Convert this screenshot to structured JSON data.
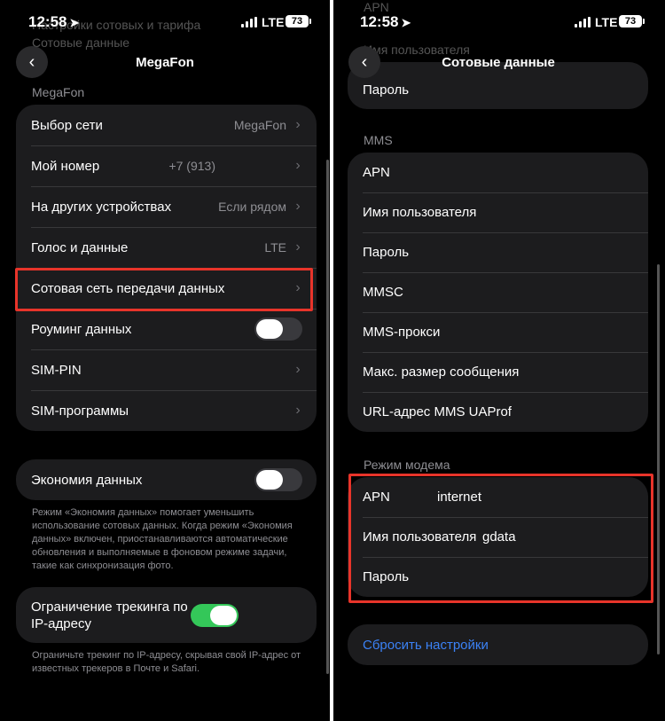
{
  "left": {
    "status": {
      "time": "12:58",
      "network": "LTE",
      "battery": "73"
    },
    "nav": {
      "title": "MegaFon"
    },
    "ghost_text": [
      "Настройки сотовых и тарифа",
      "Сотовые данные"
    ],
    "section_label": "MegaFon",
    "main_rows": [
      {
        "label": "Выбор сети",
        "value": "MegaFon"
      },
      {
        "label": "Мой номер",
        "value": "+7 (913)"
      },
      {
        "label": "На других устройствах",
        "value": "Если рядом"
      },
      {
        "label": "Голос и данные",
        "value": "LTE"
      },
      {
        "label": "Сотовая сеть передачи данных",
        "value": ""
      },
      {
        "label": "Роуминг данных",
        "toggle": false
      },
      {
        "label": "SIM-PIN",
        "value": ""
      },
      {
        "label": "SIM-программы",
        "value": ""
      }
    ],
    "economy": {
      "label": "Экономия данных",
      "toggle": false,
      "footnote": "Режим «Экономия данных» помогает уменьшить использование сотовых данных. Когда режим «Экономия данных» включен, приостанавливаются автоматические обновления и выполняемые в фоновом режиме задачи, такие как синхронизация фото."
    },
    "tracking": {
      "label": "Ограничение трекинга по IP-адресу",
      "toggle": true,
      "footnote": "Ограничьте трекинг по IP-адресу, скрывая свой IP-адрес от известных трекеров в Почте и Safari."
    }
  },
  "right": {
    "status": {
      "time": "12:58",
      "network": "LTE",
      "battery": "73"
    },
    "nav": {
      "title": "Сотовые данные"
    },
    "ghost_text": [
      "APN",
      "Имя пользователя"
    ],
    "top_password": "Пароль",
    "mms_label": "MMS",
    "mms_rows": [
      "APN",
      "Имя пользователя",
      "Пароль",
      "MMSC",
      "MMS-прокси",
      "Макс. размер сообщения",
      "URL-адрес MMS UAProf"
    ],
    "modem_label": "Режим модема",
    "modem_rows": [
      {
        "label": "APN",
        "value": "internet"
      },
      {
        "label": "Имя пользователя",
        "value": "gdata"
      },
      {
        "label": "Пароль",
        "value": ""
      }
    ],
    "reset_label": "Сбросить настройки"
  },
  "colors": {
    "accent_red": "#e8342a",
    "toggle_on": "#34c759",
    "link_blue": "#3b82f6"
  }
}
